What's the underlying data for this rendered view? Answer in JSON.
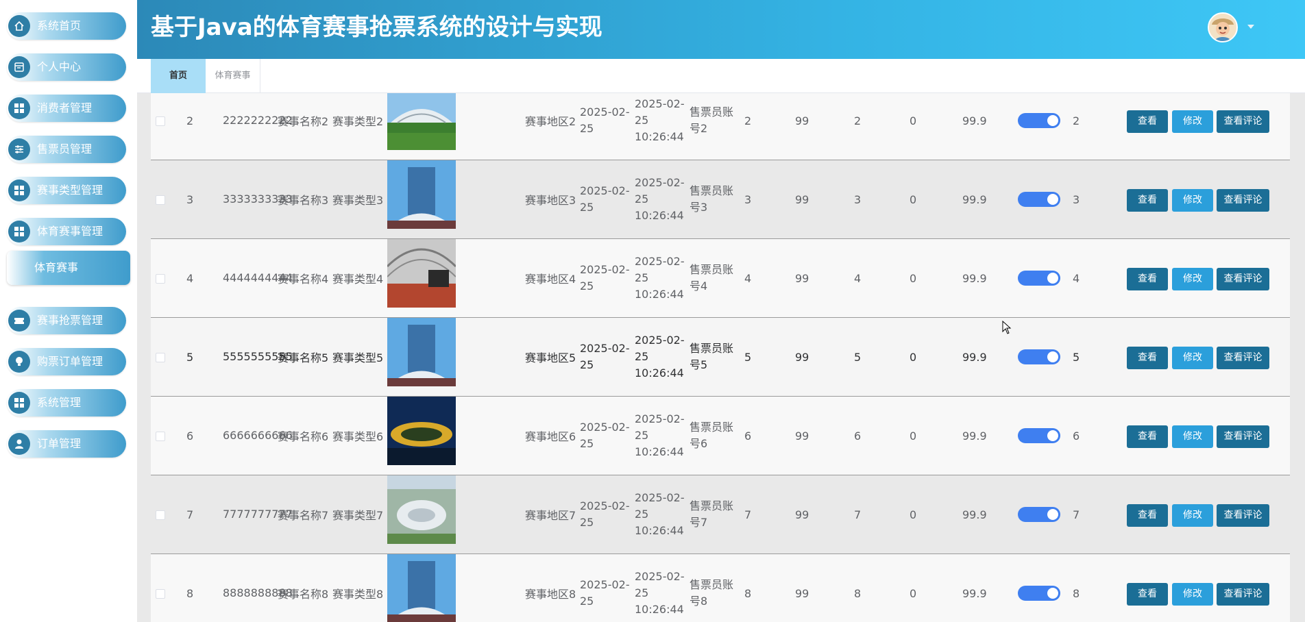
{
  "header": {
    "title": "基于Java的体育赛事抢票系统的设计与实现"
  },
  "sidebar": {
    "items": [
      {
        "label": "系统首页",
        "icon": "home-icon"
      },
      {
        "label": "个人中心",
        "icon": "profile-card-icon"
      },
      {
        "label": "消费者管理",
        "icon": "grid-icon"
      },
      {
        "label": "售票员管理",
        "icon": "sliders-icon"
      },
      {
        "label": "赛事类型管理",
        "icon": "grid-icon"
      },
      {
        "label": "体育赛事管理",
        "icon": "grid-icon"
      },
      {
        "label": "赛事抢票管理",
        "icon": "ticket-icon"
      },
      {
        "label": "购票订单管理",
        "icon": "bulb-icon"
      },
      {
        "label": "系统管理",
        "icon": "grid-icon"
      },
      {
        "label": "订单管理",
        "icon": "user-icon"
      }
    ],
    "active_submenu": "体育赛事"
  },
  "tabs": [
    {
      "label": "首页",
      "active": true
    },
    {
      "label": "体育赛事",
      "active": false
    }
  ],
  "table": {
    "rows": [
      {
        "id": "2",
        "no": "2222222222",
        "name": "赛事名称2",
        "type": "赛事类型2",
        "image": "stadium-green",
        "region": "赛事地区2",
        "date": "2025-02-25",
        "time": "2025-02-25 10:26:44",
        "account": "售票员账号2",
        "v1": "2",
        "v2": "99",
        "v3": "2",
        "v4": "0",
        "price": "99.9",
        "switch_on": true,
        "v5": "2"
      },
      {
        "id": "3",
        "no": "3333333333",
        "name": "赛事名称3",
        "type": "赛事类型3",
        "image": "tower-blue",
        "region": "赛事地区3",
        "date": "2025-02-25",
        "time": "2025-02-25 10:26:44",
        "account": "售票员账号3",
        "v1": "3",
        "v2": "99",
        "v3": "3",
        "v4": "0",
        "price": "99.9",
        "switch_on": true,
        "v5": "3"
      },
      {
        "id": "4",
        "no": "4444444444",
        "name": "赛事名称4",
        "type": "赛事类型4",
        "image": "hall-interior",
        "region": "赛事地区4",
        "date": "2025-02-25",
        "time": "2025-02-25 10:26:44",
        "account": "售票员账号4",
        "v1": "4",
        "v2": "99",
        "v3": "4",
        "v4": "0",
        "price": "99.9",
        "switch_on": true,
        "v5": "4"
      },
      {
        "id": "5",
        "no": "5555555555",
        "name": "赛事名称5",
        "type": "赛事类型5",
        "image": "tower-blue",
        "region": "赛事地区5",
        "date": "2025-02-25",
        "time": "2025-02-25 10:26:44",
        "account": "售票员账号5",
        "v1": "5",
        "v2": "99",
        "v3": "5",
        "v4": "0",
        "price": "99.9",
        "switch_on": true,
        "v5": "5"
      },
      {
        "id": "6",
        "no": "6666666666",
        "name": "赛事名称6",
        "type": "赛事类型6",
        "image": "night-stadium",
        "region": "赛事地区6",
        "date": "2025-02-25",
        "time": "2025-02-25 10:26:44",
        "account": "售票员账号6",
        "v1": "6",
        "v2": "99",
        "v3": "6",
        "v4": "0",
        "price": "99.9",
        "switch_on": true,
        "v5": "6"
      },
      {
        "id": "7",
        "no": "7777777777",
        "name": "赛事名称7",
        "type": "赛事类型7",
        "image": "aerial-stadium",
        "region": "赛事地区7",
        "date": "2025-02-25",
        "time": "2025-02-25 10:26:44",
        "account": "售票员账号7",
        "v1": "7",
        "v2": "99",
        "v3": "7",
        "v4": "0",
        "price": "99.9",
        "switch_on": true,
        "v5": "7"
      },
      {
        "id": "8",
        "no": "8888888888",
        "name": "赛事名称8",
        "type": "赛事类型8",
        "image": "tower-blue",
        "region": "赛事地区8",
        "date": "2025-02-25",
        "time": "2025-02-25 10:26:44",
        "account": "售票员账号8",
        "v1": "8",
        "v2": "99",
        "v3": "8",
        "v4": "0",
        "price": "99.9",
        "switch_on": true,
        "v5": "8"
      }
    ],
    "actions": {
      "view": "查看",
      "edit": "修改",
      "comments": "查看评论"
    }
  },
  "colors": {
    "header_start": "#2c89b8",
    "header_end": "#3ec7f6",
    "primary_button": "#1b6e96",
    "edit_button": "#2b9fdb",
    "switch_on": "#3f7ff0"
  }
}
